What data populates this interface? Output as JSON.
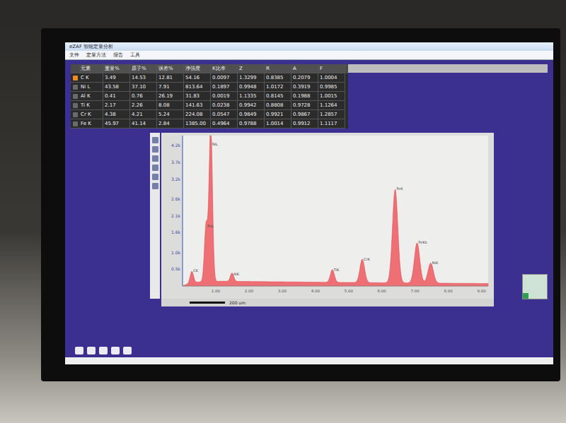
{
  "window": {
    "title": "eZAF 智能定量分析"
  },
  "menu": [
    "文件",
    "定量方法",
    "报告",
    "工具"
  ],
  "table": {
    "columns": [
      "元素",
      "重量%",
      "原子%",
      "误差%",
      "净强度",
      "K比率",
      "Z",
      "R",
      "A",
      "F"
    ],
    "rows": [
      {
        "selected": true,
        "cells": [
          "C K",
          "3.49",
          "14.53",
          "12.81",
          "54.16",
          "0.0097",
          "1.3299",
          "0.8385",
          "0.2079",
          "1.0004"
        ]
      },
      {
        "selected": false,
        "cells": [
          "Ni L",
          "43.58",
          "37.10",
          "7.91",
          "813.64",
          "0.1897",
          "0.9948",
          "1.0172",
          "0.3919",
          "0.9985"
        ]
      },
      {
        "selected": false,
        "cells": [
          "Al K",
          "0.41",
          "0.76",
          "26.19",
          "31.83",
          "0.0019",
          "1.1335",
          "0.8145",
          "0.1988",
          "1.0015"
        ]
      },
      {
        "selected": false,
        "cells": [
          "Ti K",
          "2.17",
          "2.26",
          "8.08",
          "141.63",
          "0.0238",
          "0.9942",
          "0.8808",
          "0.9728",
          "1.1264"
        ]
      },
      {
        "selected": false,
        "cells": [
          "Cr K",
          "4.38",
          "4.21",
          "5.24",
          "224.08",
          "0.0547",
          "0.9849",
          "0.9921",
          "0.9867",
          "1.2857"
        ]
      },
      {
        "selected": false,
        "cells": [
          "Fe K",
          "45.97",
          "41.14",
          "2.84",
          "1385.00",
          "0.4964",
          "0.9788",
          "1.0014",
          "0.9912",
          "1.1117"
        ]
      }
    ]
  },
  "chart": {
    "x_min": 0,
    "x_max": 9.2,
    "y_max": 4500,
    "continuum_counts": 160,
    "y_ticks": [
      {
        "label": "4.2k",
        "value": 4200
      },
      {
        "label": "3.7k",
        "value": 3700
      },
      {
        "label": "3.2k",
        "value": 3200
      },
      {
        "label": "2.6k",
        "value": 2600
      },
      {
        "label": "2.1k",
        "value": 2100
      },
      {
        "label": "1.6k",
        "value": 1600
      },
      {
        "label": "1.0k",
        "value": 1000
      },
      {
        "label": "0.5k",
        "value": 500
      }
    ],
    "x_ticks": [
      {
        "label": "1.00",
        "value": 1
      },
      {
        "label": "2.00",
        "value": 2
      },
      {
        "label": "3.00",
        "value": 3
      },
      {
        "label": "4.00",
        "value": 4
      },
      {
        "label": "5.00",
        "value": 5
      },
      {
        "label": "6.00",
        "value": 6
      },
      {
        "label": "7.00",
        "value": 7
      },
      {
        "label": "8.00",
        "value": 8
      },
      {
        "label": "9.00",
        "value": 9
      }
    ],
    "peaks": [
      {
        "label": "CK",
        "energy": 0.28,
        "counts": 350,
        "width": 0.05
      },
      {
        "label": "FeL",
        "energy": 0.71,
        "counts": 1700,
        "width": 0.05
      },
      {
        "label": "NiL",
        "energy": 0.85,
        "counts": 4700,
        "width": 0.05
      },
      {
        "label": "AlK",
        "energy": 1.49,
        "counts": 250,
        "width": 0.05
      },
      {
        "label": "TiK",
        "energy": 4.51,
        "counts": 380,
        "width": 0.06
      },
      {
        "label": "CrK",
        "energy": 5.41,
        "counts": 700,
        "width": 0.07
      },
      {
        "label": "FeK",
        "energy": 6.4,
        "counts": 2800,
        "width": 0.08
      },
      {
        "label": "FeKb",
        "energy": 7.06,
        "counts": 1200,
        "width": 0.08
      },
      {
        "label": "NiK",
        "energy": 7.47,
        "counts": 600,
        "width": 0.08
      }
    ]
  },
  "scale_bar": "200 um"
}
